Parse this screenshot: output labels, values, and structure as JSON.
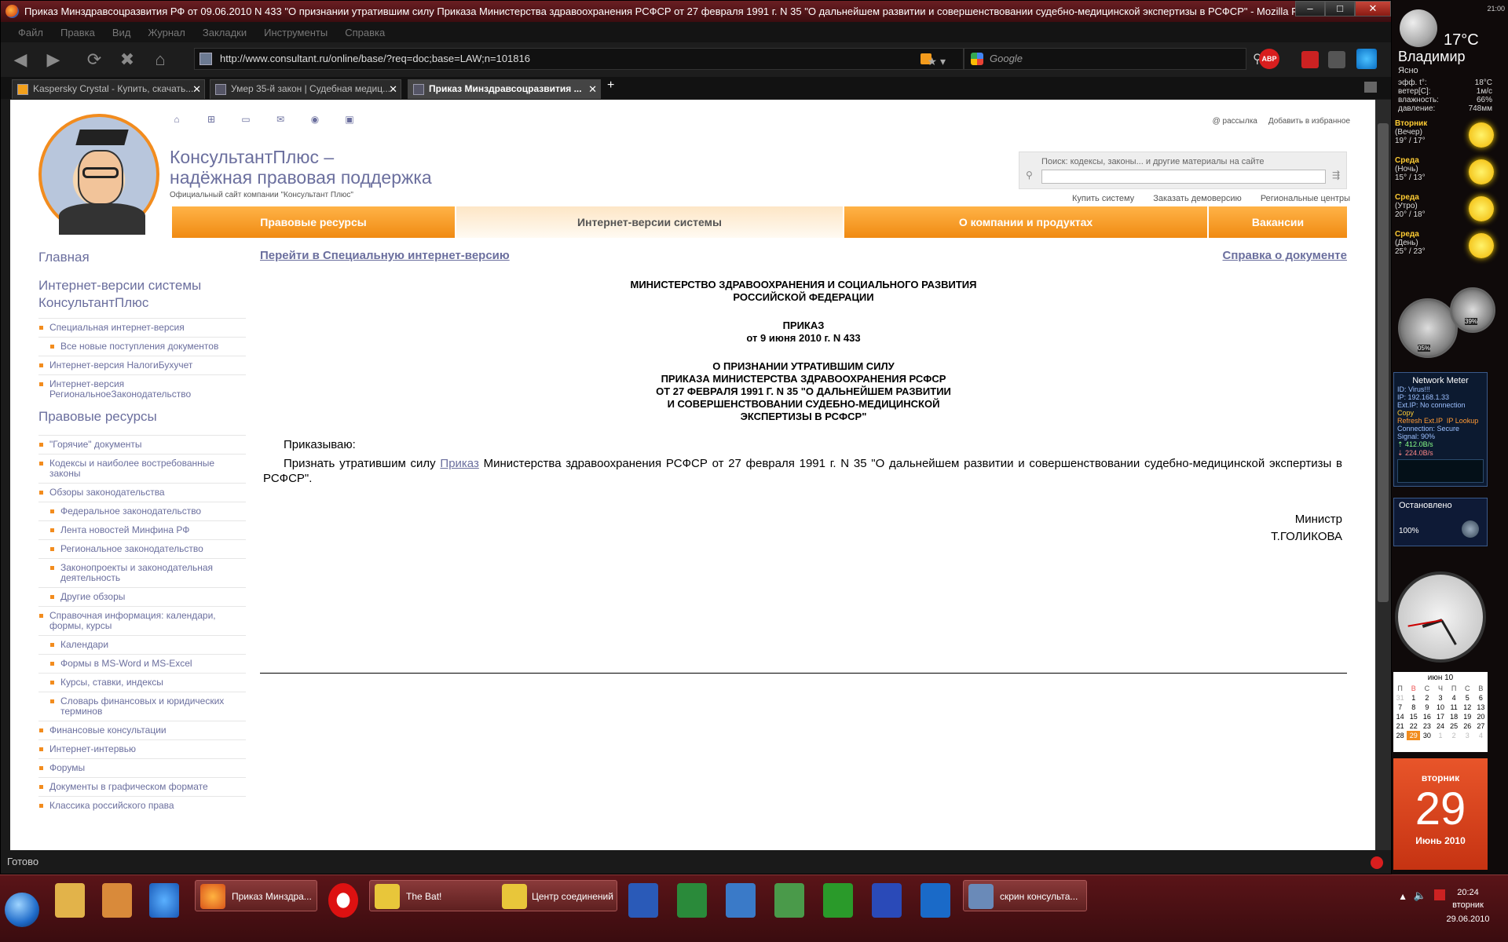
{
  "window": {
    "title": "Приказ Минздравсоцразвития РФ от 09.06.2010 N 433 \"О признании утратившим силу Приказа Министерства здравоохранения РСФСР от 27 февраля 1991 г. N 35 \"О дальнейшем развитии и совершенствовании судебно-медицинской экспертизы в РСФСР\" - Mozilla Firefox",
    "min": "–",
    "max": "□",
    "close": "✕"
  },
  "menu": [
    "Файл",
    "Правка",
    "Вид",
    "Журнал",
    "Закладки",
    "Инструменты",
    "Справка"
  ],
  "nav": {
    "url": "http://www.consultant.ru/online/base/?req=doc;base=LAW;n=101816",
    "search_placeholder": "Google",
    "back": "◀",
    "forward": "▶",
    "reload": "⟳",
    "stop": "✖",
    "home": "⌂",
    "star": "★ ▾"
  },
  "tabs": [
    {
      "label": "Kaspersky Crystal - Купить, скачать..."
    },
    {
      "label": "Умер 35-й закон | Судебная медиц..."
    },
    {
      "label": "Приказ Минздравсоцразвития ..."
    }
  ],
  "tab_new": "+",
  "status": "Готово",
  "site": {
    "brand_line1": "КонсультантПлюс –",
    "brand_line2": "надёжная правовая поддержка",
    "brand_sub": "Официальный сайт компании \"Консультант Плюс\"",
    "top_links": [
      "@ рассылка",
      "Добавить в избранное"
    ],
    "top_icons": [
      "⌂",
      "⊞",
      "▭",
      "✉",
      "◉",
      "▣"
    ],
    "search_label": "Поиск: кодексы, законы... и другие материалы на сайте",
    "search_icon": "⚲",
    "search_go": "⇶",
    "sub_links": [
      "Купить систему",
      "Заказать демоверсию",
      "Региональные центры"
    ],
    "main_nav": [
      "Правовые ресурсы",
      "Интернет-версии системы",
      "О компании и продуктах",
      "Вакансии"
    ]
  },
  "left_nav": {
    "h1": "Главная",
    "h2": "Интернет-версии системы КонсультантПлюс",
    "items1": [
      {
        "label": "Специальная интернет-версия",
        "sub": false
      },
      {
        "label": "Все новые поступления документов",
        "sub": true
      },
      {
        "label": "Интернет-версия НалогиБухучет",
        "sub": false
      },
      {
        "label": "Интернет-версия РегиональноеЗаконодательство",
        "sub": false
      }
    ],
    "h3": "Правовые ресурсы",
    "items2": [
      {
        "label": "\"Горячие\" документы",
        "sub": false
      },
      {
        "label": "Кодексы и наиболее востребованные законы",
        "sub": false
      },
      {
        "label": "Обзоры законодательства",
        "sub": false
      },
      {
        "label": "Федеральное законодательство",
        "sub": true
      },
      {
        "label": "Лента новостей Минфина РФ",
        "sub": true
      },
      {
        "label": "Региональное законодательство",
        "sub": true
      },
      {
        "label": "Законопроекты и законодательная деятельность",
        "sub": true
      },
      {
        "label": "Другие обзоры",
        "sub": true
      },
      {
        "label": "Справочная информация: календари, формы, курсы",
        "sub": false
      },
      {
        "label": "Календари",
        "sub": true
      },
      {
        "label": "Формы в MS-Word и MS-Excel",
        "sub": true
      },
      {
        "label": "Курсы, ставки, индексы",
        "sub": true
      },
      {
        "label": "Словарь финансовых и юридических терминов",
        "sub": true
      },
      {
        "label": "Финансовые консультации",
        "sub": false
      },
      {
        "label": "Интернет-интервью",
        "sub": false
      },
      {
        "label": "Форумы",
        "sub": false
      },
      {
        "label": "Документы в графическом формате",
        "sub": false
      },
      {
        "label": "Классика российского права",
        "sub": false
      }
    ]
  },
  "doc": {
    "link_left": "Перейти в Специальную интернет-версию",
    "link_right": "Справка о документе",
    "ministry1": "МИНИСТЕРСТВО ЗДРАВООХРАНЕНИЯ И СОЦИАЛЬНОГО РАЗВИТИЯ",
    "ministry2": "РОССИЙСКОЙ ФЕДЕРАЦИИ",
    "order": "ПРИКАЗ",
    "date": "от 9 июня 2010 г. N 433",
    "t1": "О ПРИЗНАНИИ УТРАТИВШИМ СИЛУ",
    "t2": "ПРИКАЗА МИНИСТЕРСТВА ЗДРАВООХРАНЕНИЯ РСФСР",
    "t3": "ОТ 27 ФЕВРАЛЯ 1991 Г. N 35 \"О ДАЛЬНЕЙШЕМ РАЗВИТИИ",
    "t4": "И СОВЕРШЕНСТВОВАНИИ СУДЕБНО-МЕДИЦИНСКОЙ",
    "t5": "ЭКСПЕРТИЗЫ В РСФСР\"",
    "p1": "Приказываю:",
    "p2a": "Признать утратившим силу ",
    "p2link": "Приказ",
    "p2b": " Министерства здравоохранения РСФСР от 27 февраля 1991 г. N 35 \"О дальнейшем развитии и совершенствовании судебно-медицинской экспертизы в РСФСР\".",
    "sign1": "Министр",
    "sign2": "Т.ГОЛИКОВА"
  },
  "gadgets": {
    "weather": {
      "temp": "17°C",
      "city": "Владимир",
      "cond": "Ясно",
      "rows": [
        [
          "эфф. t°:",
          "18°C"
        ],
        [
          "ветер[С]:",
          "1м/с"
        ],
        [
          "влажность:",
          "66%"
        ],
        [
          "давление:",
          "748мм"
        ]
      ],
      "time": "21:00",
      "forecast": [
        {
          "day": "Вторник",
          "part": "(Вечер)",
          "t": "19° / 17°"
        },
        {
          "day": "Среда",
          "part": "(Ночь)",
          "t": "15° / 13°"
        },
        {
          "day": "Среда",
          "part": "(Утро)",
          "t": "20° / 18°"
        },
        {
          "day": "Среда",
          "part": "(День)",
          "t": "25° / 23°"
        }
      ]
    },
    "cpu": {
      "a": "05%",
      "b": "39%"
    },
    "net": {
      "title": "Network Meter",
      "id": "ID: Virus!!!",
      "ip": "IP: 192.168.1.33",
      "ext": "Ext.IP: No connection",
      "copy": "Copy",
      "refresh": "Refresh Ext.IP",
      "lookup": "IP Lookup",
      "conn": "Connection: Secure",
      "signal": "Signal: 90%",
      "up": "412.0B/s",
      "down": "224.0B/s"
    },
    "media": {
      "state": "Остановлено",
      "vol": "100%"
    },
    "calendar": {
      "month": "июн 10",
      "head": [
        "П",
        "В",
        "С",
        "Ч",
        "П",
        "С",
        "В"
      ],
      "rows": [
        [
          "31",
          "1",
          "2",
          "3",
          "4",
          "5",
          "6"
        ],
        [
          "7",
          "8",
          "9",
          "10",
          "11",
          "12",
          "13"
        ],
        [
          "14",
          "15",
          "16",
          "17",
          "18",
          "19",
          "20"
        ],
        [
          "21",
          "22",
          "23",
          "24",
          "25",
          "26",
          "27"
        ],
        [
          "28",
          "29",
          "30",
          "1",
          "2",
          "3",
          "4"
        ]
      ]
    },
    "day": {
      "weekday": "вторник",
      "num": "29",
      "month": "Июнь 2010"
    }
  },
  "taskbar": {
    "buttons": [
      "Приказ Минздра...",
      "The Bat!",
      "Центр соединений",
      "скрин консульта..."
    ],
    "time": "20:24",
    "weekday": "вторник",
    "date": "29.06.2010"
  },
  "colors": {
    "accent": "#f28c1e",
    "brand": "#6b6f9e"
  }
}
